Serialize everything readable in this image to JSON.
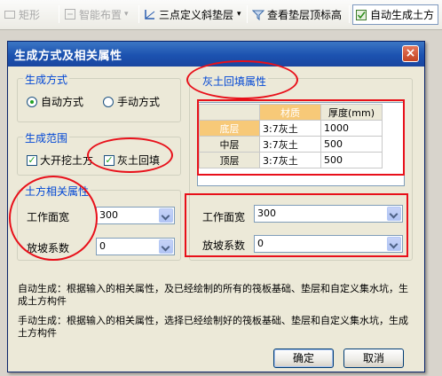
{
  "toolbar": {
    "items": [
      {
        "label": "矩形",
        "icon": "rectangle-icon",
        "disabled": true
      },
      {
        "label": "智能布置",
        "icon": "smart-layout-icon",
        "disabled": true
      },
      {
        "label": "三点定义斜垫层",
        "icon": "three-point-slope-icon",
        "disabled": false
      },
      {
        "label": "查看垫层顶标高",
        "icon": "view-elevation-icon",
        "disabled": false
      },
      {
        "label": "自动生成土方",
        "icon": "auto-generate-icon",
        "disabled": false
      }
    ]
  },
  "dialog": {
    "title": "生成方式及相关属性",
    "close_glyph": "×",
    "method": {
      "legend": "生成方式",
      "options": [
        {
          "label": "自动方式",
          "selected": true
        },
        {
          "label": "手动方式",
          "selected": false
        }
      ]
    },
    "scope": {
      "legend": "生成范围",
      "options": [
        {
          "label": "大开挖土方",
          "checked": true
        },
        {
          "label": "灰土回填",
          "checked": true
        }
      ]
    },
    "earth": {
      "legend": "土方相关属性",
      "work_width_label": "工作面宽",
      "work_width_value": "300",
      "slope_label": "放坡系数",
      "slope_value": "0"
    },
    "backfill": {
      "legend": "灰土回填属性",
      "table": {
        "headers": [
          "",
          "材质",
          "厚度(mm)"
        ],
        "rows": [
          [
            "底层",
            "3:7灰土",
            "1000"
          ],
          [
            "中层",
            "3:7灰土",
            "500"
          ],
          [
            "顶层",
            "3:7灰土",
            "500"
          ]
        ]
      },
      "work_width_label": "工作面宽",
      "work_width_value": "300",
      "slope_label": "放坡系数",
      "slope_value": "0"
    },
    "desc_auto": "自动生成：根据输入的相关属性，及已经绘制的所有的筏板基础、垫层和自定义集水坑，生成土方构件",
    "desc_manual": "手动生成：根据输入的相关属性，选择已经绘制好的筏板基础、垫层和自定义集水坑，生成土方构件",
    "ok_label": "确定",
    "cancel_label": "取消"
  },
  "colors": {
    "annotation": "#e8101a",
    "legend": "#0046d5",
    "title_bar": "#1c52b0"
  }
}
